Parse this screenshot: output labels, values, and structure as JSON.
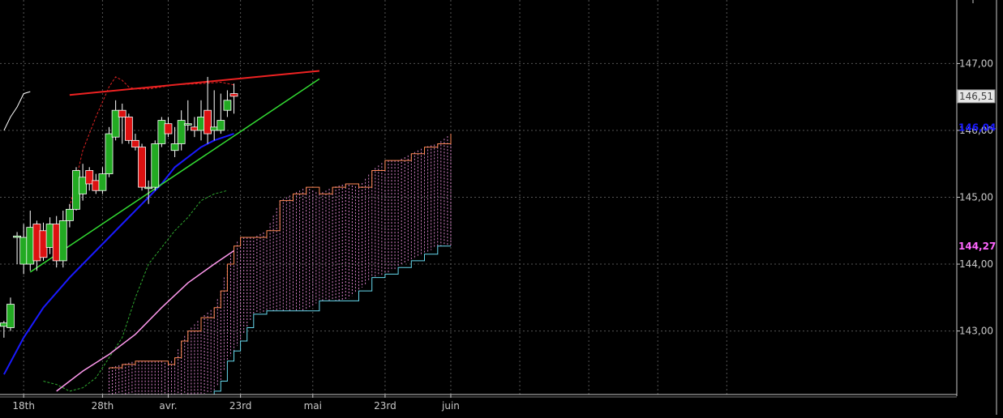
{
  "chart_data": {
    "type": "candlestick",
    "y_axis": {
      "ticks": [
        {
          "value": 143,
          "label": "143,00"
        },
        {
          "value": 144,
          "label": "144,00"
        },
        {
          "value": 145,
          "label": "145,00"
        },
        {
          "value": 146,
          "label": "146,00"
        },
        {
          "value": 147,
          "label": "147,00"
        }
      ],
      "range": [
        142.05,
        147.95
      ]
    },
    "x_axis": {
      "labels": [
        {
          "index": 3,
          "text": "18th"
        },
        {
          "index": 15,
          "text": "28th"
        },
        {
          "index": 25,
          "text": "avr."
        },
        {
          "index": 36,
          "text": "23rd"
        },
        {
          "index": 47,
          "text": "mai"
        },
        {
          "index": 58,
          "text": "23rd"
        },
        {
          "index": 68,
          "text": "juin"
        }
      ],
      "range": [
        -0.6,
        145
      ]
    },
    "price_markers": [
      {
        "value": 146.51,
        "label": "146,51",
        "style": "boxed",
        "color": "#404040"
      },
      {
        "value": 146.04,
        "label": "146,04",
        "style": "text",
        "color": "#1a1aff"
      },
      {
        "value": 144.27,
        "label": "144,27",
        "style": "text",
        "color": "#ff66ff"
      }
    ],
    "candles": [
      {
        "o": 143.07,
        "h": 143.15,
        "l": 142.9,
        "c": 143.12
      },
      {
        "o": 143.05,
        "h": 143.5,
        "l": 143.0,
        "c": 143.4
      },
      {
        "o": 144.4,
        "h": 144.48,
        "l": 144.0,
        "c": 144.42
      },
      {
        "o": 144.0,
        "h": 144.6,
        "l": 143.85,
        "c": 144.4
      },
      {
        "o": 144.0,
        "h": 144.8,
        "l": 143.9,
        "c": 144.55
      },
      {
        "o": 144.6,
        "h": 144.65,
        "l": 143.9,
        "c": 144.05
      },
      {
        "o": 144.5,
        "h": 144.62,
        "l": 144.05,
        "c": 144.1
      },
      {
        "o": 144.25,
        "h": 144.7,
        "l": 144.15,
        "c": 144.6
      },
      {
        "o": 144.6,
        "h": 144.72,
        "l": 143.95,
        "c": 144.05
      },
      {
        "o": 144.05,
        "h": 144.8,
        "l": 143.95,
        "c": 144.65
      },
      {
        "o": 144.65,
        "h": 144.9,
        "l": 144.55,
        "c": 144.82
      },
      {
        "o": 144.82,
        "h": 145.45,
        "l": 144.8,
        "c": 145.4
      },
      {
        "o": 145.05,
        "h": 145.5,
        "l": 144.95,
        "c": 145.3
      },
      {
        "o": 145.4,
        "h": 145.45,
        "l": 145.1,
        "c": 145.2
      },
      {
        "o": 145.25,
        "h": 145.35,
        "l": 145.05,
        "c": 145.1
      },
      {
        "o": 145.1,
        "h": 145.45,
        "l": 145.05,
        "c": 145.35
      },
      {
        "o": 145.35,
        "h": 146.05,
        "l": 145.3,
        "c": 145.95
      },
      {
        "o": 145.9,
        "h": 146.45,
        "l": 145.85,
        "c": 146.3
      },
      {
        "o": 146.3,
        "h": 146.4,
        "l": 145.8,
        "c": 146.2
      },
      {
        "o": 146.2,
        "h": 146.25,
        "l": 145.8,
        "c": 145.85
      },
      {
        "o": 145.85,
        "h": 145.95,
        "l": 145.7,
        "c": 145.75
      },
      {
        "o": 145.75,
        "h": 145.8,
        "l": 145.1,
        "c": 145.15
      },
      {
        "o": 145.13,
        "h": 145.25,
        "l": 144.9,
        "c": 145.15
      },
      {
        "o": 145.15,
        "h": 145.85,
        "l": 145.1,
        "c": 145.8
      },
      {
        "o": 145.8,
        "h": 146.2,
        "l": 145.75,
        "c": 146.15
      },
      {
        "o": 146.1,
        "h": 146.2,
        "l": 145.9,
        "c": 145.95
      },
      {
        "o": 145.7,
        "h": 146.05,
        "l": 145.6,
        "c": 145.8
      },
      {
        "o": 145.8,
        "h": 146.3,
        "l": 145.7,
        "c": 146.15
      },
      {
        "o": 146.08,
        "h": 146.45,
        "l": 146.0,
        "c": 146.1
      },
      {
        "o": 146.05,
        "h": 146.2,
        "l": 145.9,
        "c": 146.0
      },
      {
        "o": 146.0,
        "h": 146.45,
        "l": 145.85,
        "c": 146.2
      },
      {
        "o": 146.3,
        "h": 146.8,
        "l": 145.8,
        "c": 145.95
      },
      {
        "o": 146.0,
        "h": 146.6,
        "l": 145.85,
        "c": 146.05
      },
      {
        "o": 146.0,
        "h": 146.55,
        "l": 145.95,
        "c": 146.15
      },
      {
        "o": 146.3,
        "h": 146.6,
        "l": 146.2,
        "c": 146.45
      },
      {
        "o": 146.55,
        "h": 146.7,
        "l": 146.25,
        "c": 146.51
      }
    ],
    "series": [
      {
        "id": "blue-ma",
        "color": "#1a1aff",
        "width": 2,
        "dash": "",
        "x": [
          0,
          3,
          6,
          10,
          14,
          18,
          22,
          24,
          26,
          28,
          30,
          32,
          35
        ],
        "y": [
          142.35,
          142.9,
          143.35,
          143.8,
          144.2,
          144.6,
          145.0,
          145.2,
          145.45,
          145.6,
          145.75,
          145.85,
          145.95
        ]
      },
      {
        "id": "green-trend",
        "color": "#33dd33",
        "width": 1.5,
        "dash": "",
        "x": [
          4,
          48
        ],
        "y": [
          143.88,
          146.77
        ]
      },
      {
        "id": "red-trend",
        "color": "#ee2222",
        "width": 2,
        "dash": "",
        "x": [
          10,
          48
        ],
        "y": [
          146.53,
          146.89
        ]
      },
      {
        "id": "red-dashed",
        "color": "#dd2222",
        "width": 1,
        "dash": "3,2",
        "x": [
          10,
          12,
          14,
          16,
          17,
          18,
          19,
          20,
          22,
          26,
          30,
          33,
          35
        ],
        "y": [
          144.85,
          145.7,
          146.2,
          146.65,
          146.8,
          146.75,
          146.65,
          146.62,
          146.62,
          146.68,
          146.7,
          146.72,
          146.68
        ]
      },
      {
        "id": "green-dashed",
        "color": "#2fa82f",
        "width": 1,
        "dash": "3,2",
        "x": [
          6,
          8,
          10,
          12,
          14,
          18,
          20,
          22,
          24,
          26,
          28,
          30,
          32,
          34
        ],
        "y": [
          142.25,
          142.2,
          142.1,
          142.15,
          142.3,
          142.9,
          143.5,
          144.0,
          144.25,
          144.5,
          144.7,
          144.95,
          145.05,
          145.1
        ]
      },
      {
        "id": "pink-line",
        "color": "#ff99ee",
        "width": 1.5,
        "dash": "",
        "x": [
          8,
          12,
          16,
          20,
          24,
          28,
          32,
          35
        ],
        "y": [
          142.1,
          142.4,
          142.65,
          142.95,
          143.35,
          143.72,
          144.0,
          144.2
        ]
      },
      {
        "id": "white-fragment",
        "color": "#ffffff",
        "width": 1,
        "dash": "",
        "x": [
          0,
          1,
          2,
          3,
          4
        ],
        "y": [
          146.0,
          146.2,
          146.35,
          146.55,
          146.58
        ]
      }
    ],
    "cloud": {
      "x": [
        16,
        18,
        20,
        22,
        24,
        25,
        26,
        27,
        28,
        30,
        32,
        33,
        34,
        35,
        36,
        37,
        38,
        40,
        42,
        44,
        46,
        48,
        50,
        52,
        54,
        56,
        58,
        60,
        62,
        64,
        66,
        68
      ],
      "span_a": [
        142.45,
        142.5,
        142.55,
        142.55,
        142.55,
        142.5,
        142.6,
        142.85,
        143.0,
        143.2,
        143.35,
        143.6,
        144.0,
        144.27,
        144.4,
        144.4,
        144.4,
        144.5,
        144.95,
        145.05,
        145.15,
        145.05,
        145.15,
        145.2,
        145.15,
        145.4,
        145.55,
        145.55,
        145.65,
        145.75,
        145.8,
        145.95
      ],
      "span_b": [
        142.05,
        142.05,
        142.05,
        142.05,
        142.05,
        142.05,
        142.05,
        142.05,
        142.05,
        142.05,
        142.1,
        142.25,
        142.55,
        142.7,
        142.85,
        143.05,
        143.25,
        143.3,
        143.3,
        143.3,
        143.3,
        143.45,
        143.45,
        143.45,
        143.6,
        143.8,
        143.85,
        143.95,
        144.05,
        144.15,
        144.27,
        144.27
      ]
    },
    "colors": {
      "background": "#000000",
      "grid": "#555555",
      "axis": "#c8c8c8",
      "candle_up": "#22aa22",
      "candle_down": "#dd1111",
      "span_a": "#ff8855",
      "span_b": "#66d9ee",
      "cloud_fill": "#ff99ee"
    }
  }
}
